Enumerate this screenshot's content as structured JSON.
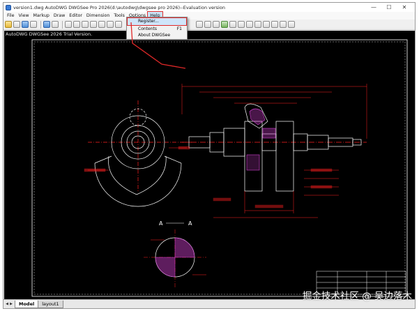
{
  "window": {
    "title": "version1.dwg AutoDWG DWGSee Pro 2026(d:\\autodwg\\dwgsee pro 2026)--Evaluation version",
    "controls": [
      "—",
      "☐",
      "✕"
    ]
  },
  "menu": {
    "items": [
      "File",
      "View",
      "Markup",
      "Draw",
      "Editor",
      "Dimension",
      "Tools",
      "Options",
      "Help"
    ],
    "active_item": "Help"
  },
  "help_menu": {
    "items": [
      {
        "label": "Register...",
        "shortcut": "",
        "highlighted": true
      },
      {
        "label": "Contents",
        "shortcut": "F1",
        "highlighted": false
      },
      {
        "label": "About DWGSee",
        "shortcut": "",
        "highlighted": false
      }
    ]
  },
  "canvas": {
    "trial_notice": "AutoDWG DWGSee 2026 Trial Version.",
    "section_mark": "A",
    "drawing_colors": {
      "background": "#000000",
      "geometry": "#ffffff",
      "dimensions": "#ff2020",
      "hatch": "#d040d0",
      "border": "#ffffff"
    }
  },
  "layout_tabs": {
    "nav": [
      "◀",
      "▶"
    ],
    "tabs": [
      "Model",
      "layout1"
    ],
    "active": "Model"
  },
  "watermark": "掘金技术社区 @ 吴边落木",
  "annotation_color": "#e02828"
}
